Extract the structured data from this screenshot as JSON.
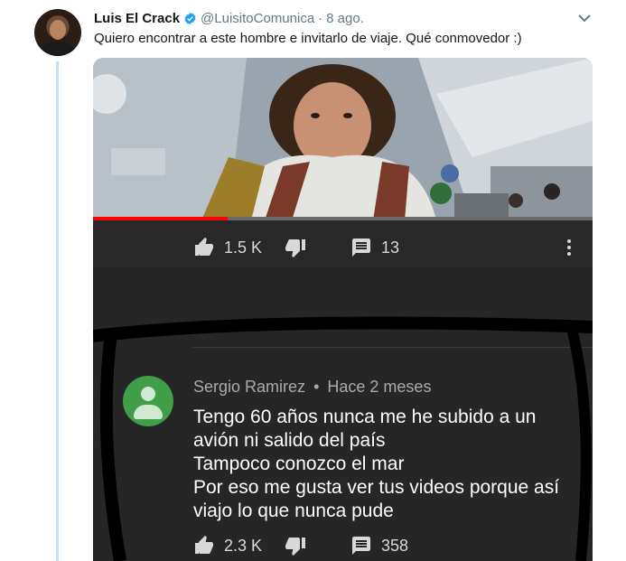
{
  "tweet": {
    "author_name": "Luis El Crack",
    "handle": "@LuisitoComunica",
    "separator": "·",
    "time": "8 ago.",
    "text": "Quiero encontrar a este hombre e invitarlo de viaje. Qué conmovedor :)"
  },
  "video_actions": {
    "likes": "1.5 K",
    "comments": "13"
  },
  "comment": {
    "author": "Sergio Ramirez",
    "separator": "•",
    "time": "Hace 2 meses",
    "lines": [
      "Tengo 60 años nunca me he subido  a un",
      "avión ni salido del país",
      "Tampoco conozco el mar",
      "Por eso me gusta ver tus videos porque así",
      "viajo lo que nunca pude"
    ],
    "likes": "2.3 K",
    "replies": "358"
  },
  "video_progress": 0.27,
  "colors": {
    "verified": "#1da1f2",
    "progress": "#ff0000",
    "comment_avatar": "#3f9e47",
    "thread_line": "#c4e0f2"
  },
  "icons": [
    "verified-icon",
    "chevron-down-icon",
    "thumbs-up-icon",
    "thumbs-down-icon",
    "comment-icon",
    "more-vert-icon"
  ]
}
